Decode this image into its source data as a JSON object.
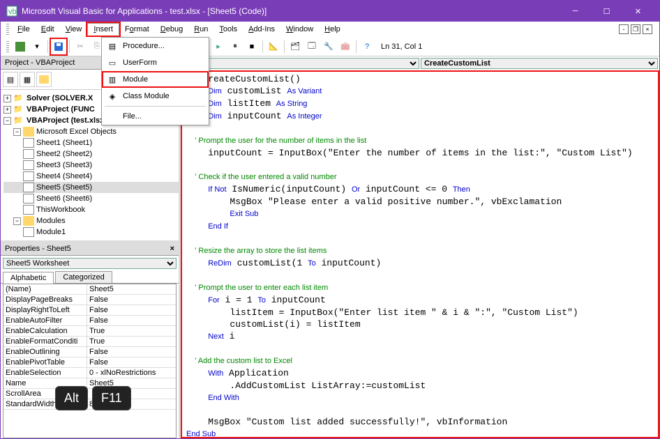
{
  "window": {
    "title": "Microsoft Visual Basic for Applications - test.xlsx - [Sheet5 (Code)]"
  },
  "menubar": {
    "file": "File",
    "edit": "Edit",
    "view": "View",
    "insert": "Insert",
    "format": "Format",
    "debug": "Debug",
    "run": "Run",
    "tools": "Tools",
    "addins": "Add-Ins",
    "window": "Window",
    "help": "Help"
  },
  "insert_menu": {
    "procedure": "Procedure...",
    "userform": "UserForm",
    "module": "Module",
    "class_module": "Class Module",
    "file": "File..."
  },
  "cursor_position": "Ln 31, Col 1",
  "project_panel": {
    "title": "Project - VBAProject",
    "nodes": {
      "solver": "Solver (SOLVER.X",
      "func": "VBAProject (FUNC",
      "test": "VBAProject (test.xlsx)",
      "excel_objects": "Microsoft Excel Objects",
      "sheets": [
        "Sheet1 (Sheet1)",
        "Sheet2 (Sheet2)",
        "Sheet3 (Sheet3)",
        "Sheet4 (Sheet4)",
        "Sheet5 (Sheet5)",
        "Sheet6 (Sheet6)"
      ],
      "thisworkbook": "ThisWorkbook",
      "modules": "Modules",
      "module1": "Module1"
    }
  },
  "properties_panel": {
    "title": "Properties - Sheet5",
    "selector": "Sheet5 Worksheet",
    "tabs": {
      "alphabetic": "Alphabetic",
      "categorized": "Categorized"
    },
    "rows": [
      {
        "name": "(Name)",
        "value": "Sheet5"
      },
      {
        "name": "DisplayPageBreaks",
        "value": "False"
      },
      {
        "name": "DisplayRightToLeft",
        "value": "False"
      },
      {
        "name": "EnableAutoFilter",
        "value": "False"
      },
      {
        "name": "EnableCalculation",
        "value": "True"
      },
      {
        "name": "EnableFormatConditi",
        "value": "True"
      },
      {
        "name": "EnableOutlining",
        "value": "False"
      },
      {
        "name": "EnablePivotTable",
        "value": "False"
      },
      {
        "name": "EnableSelection",
        "value": "0 - xlNoRestrictions"
      },
      {
        "name": "Name",
        "value": "Sheet5"
      },
      {
        "name": "ScrollArea",
        "value": ""
      },
      {
        "name": "StandardWidth",
        "value": "8.43"
      }
    ]
  },
  "code_dropdowns": {
    "left": "al)",
    "right": "CreateCustomList"
  },
  "code_lines": [
    {
      "t": "plain",
      "s": "   CreateCustomList()"
    },
    {
      "t": "mixed",
      "s": "    <k>Dim</k> customList <k>As Variant</k>"
    },
    {
      "t": "mixed",
      "s": "    <k>Dim</k> listItem <k>As String</k>"
    },
    {
      "t": "mixed",
      "s": "    <k>Dim</k> inputCount <k>As Integer</k>"
    },
    {
      "t": "blank",
      "s": ""
    },
    {
      "t": "comment",
      "s": "    ' Prompt the user for the number of items in the list"
    },
    {
      "t": "plain",
      "s": "    inputCount = InputBox(\"Enter the number of items in the list:\", \"Custom List\")"
    },
    {
      "t": "blank",
      "s": ""
    },
    {
      "t": "comment",
      "s": "    ' Check if the user entered a valid number"
    },
    {
      "t": "mixed",
      "s": "    <k>If Not</k> IsNumeric(inputCount) <k>Or</k> inputCount <= 0 <k>Then</k>"
    },
    {
      "t": "plain",
      "s": "        MsgBox \"Please enter a valid positive number.\", vbExclamation"
    },
    {
      "t": "mixed",
      "s": "        <k>Exit Sub</k>"
    },
    {
      "t": "mixed",
      "s": "    <k>End If</k>"
    },
    {
      "t": "blank",
      "s": ""
    },
    {
      "t": "comment",
      "s": "    ' Resize the array to store the list items"
    },
    {
      "t": "mixed",
      "s": "    <k>ReDim</k> customList(1 <k>To</k> inputCount)"
    },
    {
      "t": "blank",
      "s": ""
    },
    {
      "t": "comment",
      "s": "    ' Prompt the user to enter each list item"
    },
    {
      "t": "mixed",
      "s": "    <k>For</k> i = 1 <k>To</k> inputCount"
    },
    {
      "t": "plain",
      "s": "        listItem = InputBox(\"Enter list item \" & i & \":\", \"Custom List\")"
    },
    {
      "t": "plain",
      "s": "        customList(i) = listItem"
    },
    {
      "t": "mixed",
      "s": "    <k>Next</k> i"
    },
    {
      "t": "blank",
      "s": ""
    },
    {
      "t": "comment",
      "s": "    ' Add the custom list to Excel"
    },
    {
      "t": "mixed",
      "s": "    <k>With</k> Application"
    },
    {
      "t": "plain",
      "s": "        .AddCustomList ListArray:=customList"
    },
    {
      "t": "mixed",
      "s": "    <k>End With</k>"
    },
    {
      "t": "blank",
      "s": ""
    },
    {
      "t": "plain",
      "s": "    MsgBox \"Custom list added successfully!\", vbInformation"
    },
    {
      "t": "mixed",
      "s": "<k>End Sub</k>"
    }
  ],
  "key_hint": {
    "k1": "Alt",
    "k2": "F11"
  }
}
